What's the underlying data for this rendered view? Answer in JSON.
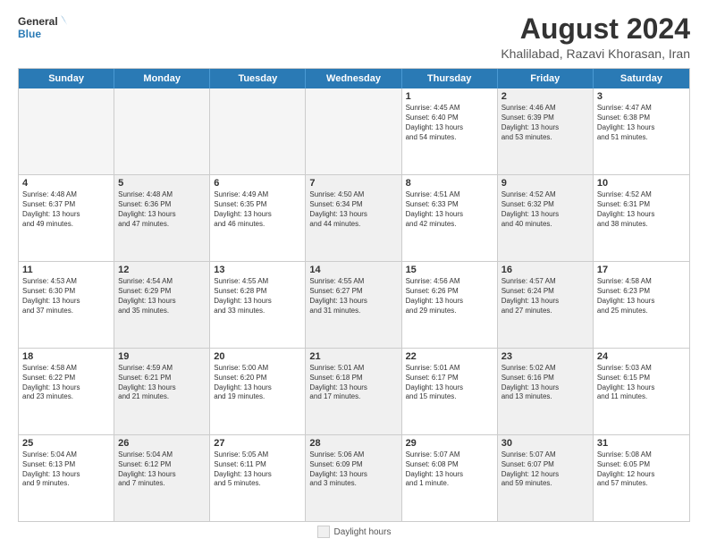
{
  "logo": {
    "line1": "General",
    "line2": "Blue"
  },
  "title": "August 2024",
  "location": "Khalilabad, Razavi Khorasan, Iran",
  "days_of_week": [
    "Sunday",
    "Monday",
    "Tuesday",
    "Wednesday",
    "Thursday",
    "Friday",
    "Saturday"
  ],
  "footer": {
    "daylight_label": "Daylight hours"
  },
  "weeks": [
    [
      {
        "day": "",
        "text": "",
        "empty": true
      },
      {
        "day": "",
        "text": "",
        "empty": true
      },
      {
        "day": "",
        "text": "",
        "empty": true
      },
      {
        "day": "",
        "text": "",
        "empty": true
      },
      {
        "day": "1",
        "text": "Sunrise: 4:45 AM\nSunset: 6:40 PM\nDaylight: 13 hours\nand 54 minutes.",
        "empty": false,
        "shaded": false
      },
      {
        "day": "2",
        "text": "Sunrise: 4:46 AM\nSunset: 6:39 PM\nDaylight: 13 hours\nand 53 minutes.",
        "empty": false,
        "shaded": true
      },
      {
        "day": "3",
        "text": "Sunrise: 4:47 AM\nSunset: 6:38 PM\nDaylight: 13 hours\nand 51 minutes.",
        "empty": false,
        "shaded": false
      }
    ],
    [
      {
        "day": "4",
        "text": "Sunrise: 4:48 AM\nSunset: 6:37 PM\nDaylight: 13 hours\nand 49 minutes.",
        "empty": false,
        "shaded": false
      },
      {
        "day": "5",
        "text": "Sunrise: 4:48 AM\nSunset: 6:36 PM\nDaylight: 13 hours\nand 47 minutes.",
        "empty": false,
        "shaded": true
      },
      {
        "day": "6",
        "text": "Sunrise: 4:49 AM\nSunset: 6:35 PM\nDaylight: 13 hours\nand 46 minutes.",
        "empty": false,
        "shaded": false
      },
      {
        "day": "7",
        "text": "Sunrise: 4:50 AM\nSunset: 6:34 PM\nDaylight: 13 hours\nand 44 minutes.",
        "empty": false,
        "shaded": true
      },
      {
        "day": "8",
        "text": "Sunrise: 4:51 AM\nSunset: 6:33 PM\nDaylight: 13 hours\nand 42 minutes.",
        "empty": false,
        "shaded": false
      },
      {
        "day": "9",
        "text": "Sunrise: 4:52 AM\nSunset: 6:32 PM\nDaylight: 13 hours\nand 40 minutes.",
        "empty": false,
        "shaded": true
      },
      {
        "day": "10",
        "text": "Sunrise: 4:52 AM\nSunset: 6:31 PM\nDaylight: 13 hours\nand 38 minutes.",
        "empty": false,
        "shaded": false
      }
    ],
    [
      {
        "day": "11",
        "text": "Sunrise: 4:53 AM\nSunset: 6:30 PM\nDaylight: 13 hours\nand 37 minutes.",
        "empty": false,
        "shaded": false
      },
      {
        "day": "12",
        "text": "Sunrise: 4:54 AM\nSunset: 6:29 PM\nDaylight: 13 hours\nand 35 minutes.",
        "empty": false,
        "shaded": true
      },
      {
        "day": "13",
        "text": "Sunrise: 4:55 AM\nSunset: 6:28 PM\nDaylight: 13 hours\nand 33 minutes.",
        "empty": false,
        "shaded": false
      },
      {
        "day": "14",
        "text": "Sunrise: 4:55 AM\nSunset: 6:27 PM\nDaylight: 13 hours\nand 31 minutes.",
        "empty": false,
        "shaded": true
      },
      {
        "day": "15",
        "text": "Sunrise: 4:56 AM\nSunset: 6:26 PM\nDaylight: 13 hours\nand 29 minutes.",
        "empty": false,
        "shaded": false
      },
      {
        "day": "16",
        "text": "Sunrise: 4:57 AM\nSunset: 6:24 PM\nDaylight: 13 hours\nand 27 minutes.",
        "empty": false,
        "shaded": true
      },
      {
        "day": "17",
        "text": "Sunrise: 4:58 AM\nSunset: 6:23 PM\nDaylight: 13 hours\nand 25 minutes.",
        "empty": false,
        "shaded": false
      }
    ],
    [
      {
        "day": "18",
        "text": "Sunrise: 4:58 AM\nSunset: 6:22 PM\nDaylight: 13 hours\nand 23 minutes.",
        "empty": false,
        "shaded": false
      },
      {
        "day": "19",
        "text": "Sunrise: 4:59 AM\nSunset: 6:21 PM\nDaylight: 13 hours\nand 21 minutes.",
        "empty": false,
        "shaded": true
      },
      {
        "day": "20",
        "text": "Sunrise: 5:00 AM\nSunset: 6:20 PM\nDaylight: 13 hours\nand 19 minutes.",
        "empty": false,
        "shaded": false
      },
      {
        "day": "21",
        "text": "Sunrise: 5:01 AM\nSunset: 6:18 PM\nDaylight: 13 hours\nand 17 minutes.",
        "empty": false,
        "shaded": true
      },
      {
        "day": "22",
        "text": "Sunrise: 5:01 AM\nSunset: 6:17 PM\nDaylight: 13 hours\nand 15 minutes.",
        "empty": false,
        "shaded": false
      },
      {
        "day": "23",
        "text": "Sunrise: 5:02 AM\nSunset: 6:16 PM\nDaylight: 13 hours\nand 13 minutes.",
        "empty": false,
        "shaded": true
      },
      {
        "day": "24",
        "text": "Sunrise: 5:03 AM\nSunset: 6:15 PM\nDaylight: 13 hours\nand 11 minutes.",
        "empty": false,
        "shaded": false
      }
    ],
    [
      {
        "day": "25",
        "text": "Sunrise: 5:04 AM\nSunset: 6:13 PM\nDaylight: 13 hours\nand 9 minutes.",
        "empty": false,
        "shaded": false
      },
      {
        "day": "26",
        "text": "Sunrise: 5:04 AM\nSunset: 6:12 PM\nDaylight: 13 hours\nand 7 minutes.",
        "empty": false,
        "shaded": true
      },
      {
        "day": "27",
        "text": "Sunrise: 5:05 AM\nSunset: 6:11 PM\nDaylight: 13 hours\nand 5 minutes.",
        "empty": false,
        "shaded": false
      },
      {
        "day": "28",
        "text": "Sunrise: 5:06 AM\nSunset: 6:09 PM\nDaylight: 13 hours\nand 3 minutes.",
        "empty": false,
        "shaded": true
      },
      {
        "day": "29",
        "text": "Sunrise: 5:07 AM\nSunset: 6:08 PM\nDaylight: 13 hours\nand 1 minute.",
        "empty": false,
        "shaded": false
      },
      {
        "day": "30",
        "text": "Sunrise: 5:07 AM\nSunset: 6:07 PM\nDaylight: 12 hours\nand 59 minutes.",
        "empty": false,
        "shaded": true
      },
      {
        "day": "31",
        "text": "Sunrise: 5:08 AM\nSunset: 6:05 PM\nDaylight: 12 hours\nand 57 minutes.",
        "empty": false,
        "shaded": false
      }
    ]
  ]
}
